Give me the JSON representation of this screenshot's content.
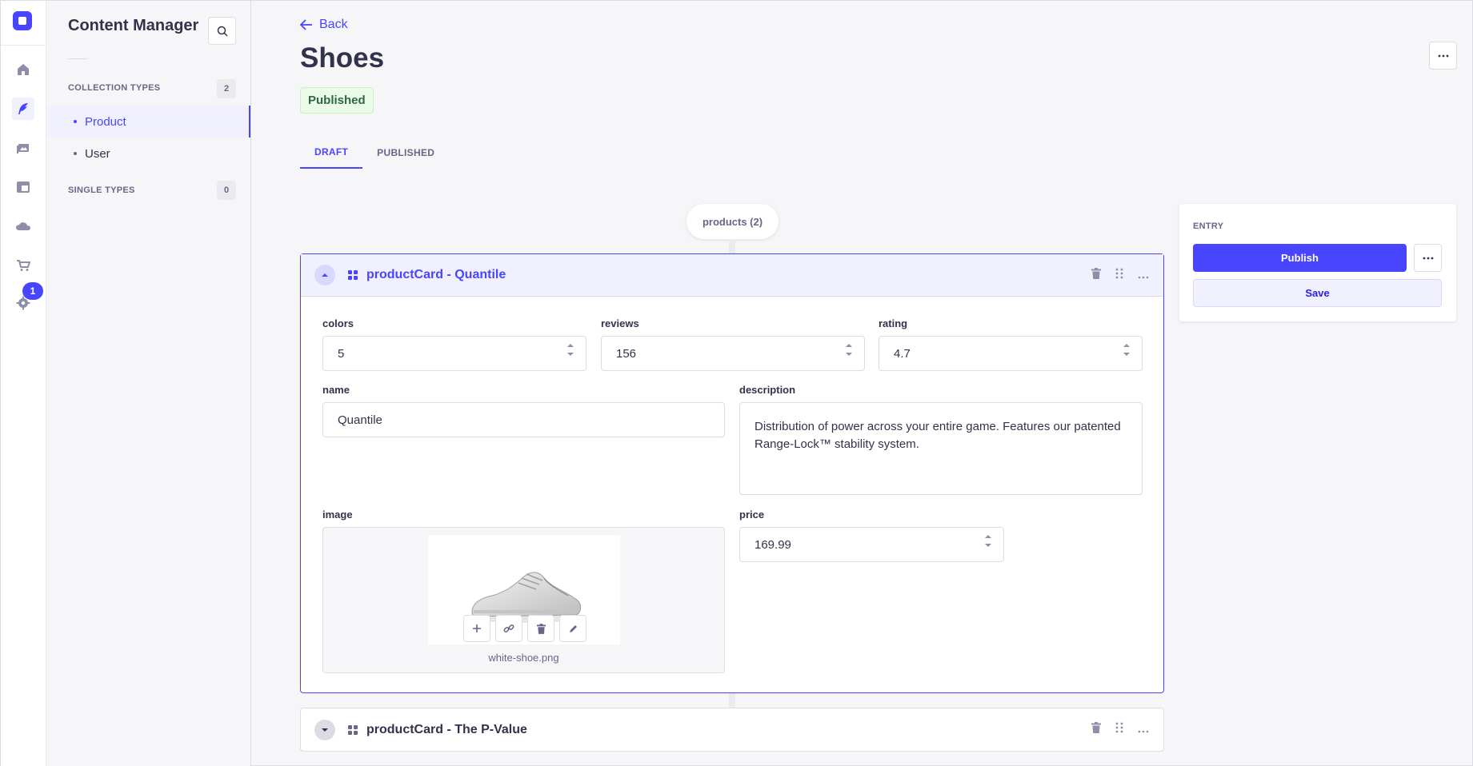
{
  "rail": {
    "icons": [
      "logo-icon",
      "home-icon",
      "feather-icon",
      "media-icon",
      "layout-icon",
      "cloud-icon",
      "cart-icon",
      "gear-icon"
    ],
    "settings_badge": "1"
  },
  "subnav": {
    "title": "Content Manager",
    "collection_types_label": "COLLECTION TYPES",
    "collection_types_count": "2",
    "items": [
      {
        "label": "Product",
        "active": true
      },
      {
        "label": "User",
        "active": false
      }
    ],
    "single_types_label": "SINGLE TYPES",
    "single_types_count": "0"
  },
  "header": {
    "back_label": "Back",
    "title": "Shoes",
    "status": "Published"
  },
  "tabs": [
    {
      "label": "DRAFT",
      "active": true
    },
    {
      "label": "PUBLISHED",
      "active": false
    }
  ],
  "component_pill": "products (2)",
  "cards": [
    {
      "title": "productCard - Quantile",
      "expanded": true,
      "fields": {
        "colors": {
          "label": "colors",
          "value": "5"
        },
        "reviews": {
          "label": "reviews",
          "value": "156"
        },
        "rating": {
          "label": "rating",
          "value": "4.7"
        },
        "name": {
          "label": "name",
          "value": "Quantile"
        },
        "description": {
          "label": "description",
          "value": "Distribution of power across your entire game. Features our patented Range-Lock™ stability system."
        },
        "image": {
          "label": "image",
          "filename": "white-shoe.png"
        },
        "price": {
          "label": "price",
          "value": "169.99"
        }
      }
    },
    {
      "title": "productCard - The P-Value",
      "expanded": false
    }
  ],
  "entry": {
    "label": "ENTRY",
    "publish_label": "Publish",
    "save_label": "Save"
  },
  "colors": {
    "primary": "#4945ff",
    "published_bg": "#eafbe7",
    "published_text": "#2f6846"
  }
}
